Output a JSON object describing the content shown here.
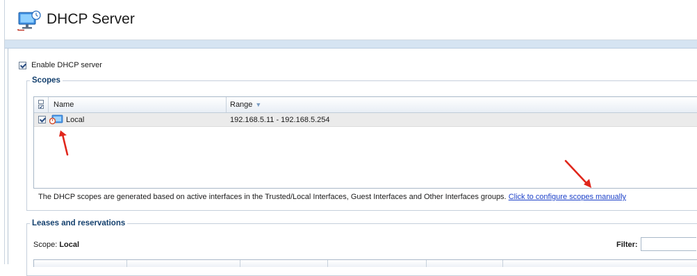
{
  "page": {
    "title": "DHCP Server",
    "icon": "dhcp-server-icon"
  },
  "enable": {
    "label": "Enable DHCP server",
    "checked": true
  },
  "scopes": {
    "title": "Scopes",
    "columns": {
      "name": "Name",
      "range": "Range",
      "range_sort": "descending"
    },
    "rows": [
      {
        "name": "Local",
        "range": "192.168.5.11 - 192.168.5.254",
        "checked": true,
        "icon": "network-scope-icon"
      }
    ],
    "note": "The DHCP scopes are generated based on active interfaces in the Trusted/Local Interfaces, Guest Interfaces and Other Interfaces groups.",
    "link": "Click to configure scopes manually"
  },
  "leases": {
    "title": "Leases and reservations",
    "scope_prefix": "Scope:",
    "scope_value": "Local",
    "filter_label": "Filter:",
    "filter_value": ""
  },
  "annotations": {
    "arrow_color": "#e0261b"
  },
  "colors": {
    "accent": "#14406e",
    "link": "#1a3fc8",
    "band": "#d6e4f2"
  }
}
